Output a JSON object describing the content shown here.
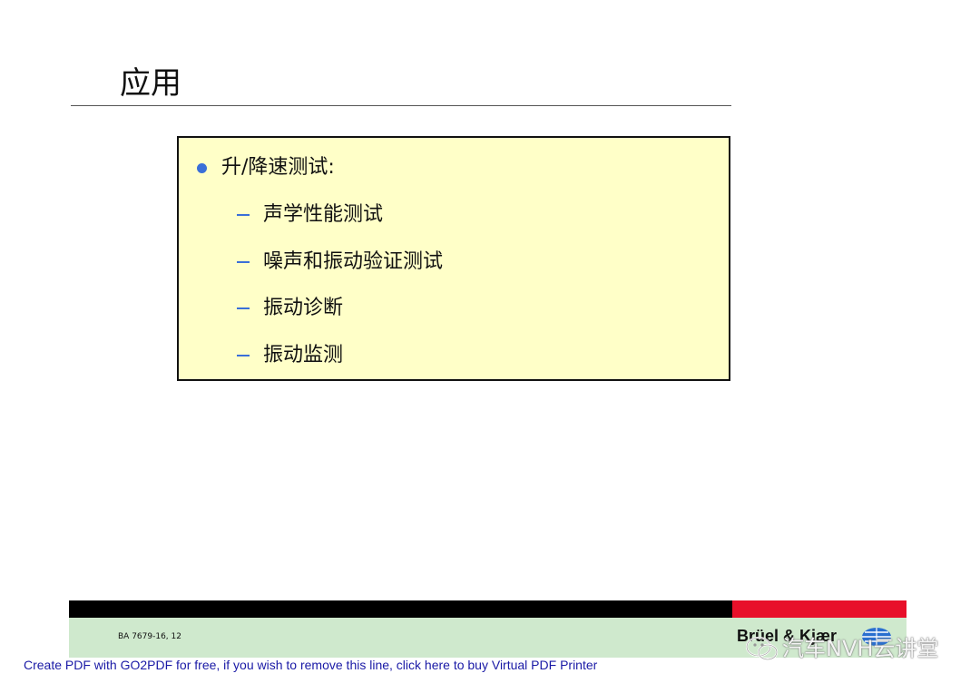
{
  "slide": {
    "title": "应用"
  },
  "content": {
    "bullet": "升/降速测试:",
    "sub_items": [
      "声学性能测试",
      "噪声和振动验证测试",
      "振动诊断",
      "振动监测"
    ]
  },
  "footer": {
    "reference": "BA 7679-16, 12",
    "brand": "Brüel & Kjær",
    "pdf_notice": "Create PDF with GO2PDF for free, if you wish to remove this line, click here to buy Virtual PDF Printer"
  },
  "watermark": {
    "text": "汽车NVH云讲堂"
  },
  "colors": {
    "box_fill": "#ffffc8",
    "bullet_blue": "#3a6fd8",
    "footer_black": "#000000",
    "footer_red": "#e8102a",
    "footer_green": "#cfe9cd",
    "link_blue": "#1a1aa6"
  }
}
